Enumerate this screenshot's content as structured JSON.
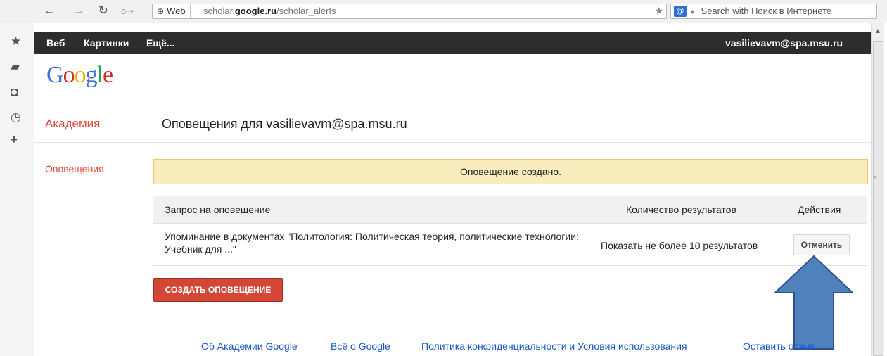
{
  "browser": {
    "back_icon": "arrow-left-icon",
    "forward_icon": "arrow-right-icon",
    "reload_icon": "reload-icon",
    "key_icon": "key-icon",
    "web_label": "Web",
    "url_prefix": "scholar.",
    "url_domain": "google.ru",
    "url_path": "/scholar_alerts",
    "search_placeholder": "Search with Поиск в Интернете"
  },
  "gbar": {
    "items": [
      "Веб",
      "Картинки",
      "Ещё..."
    ],
    "user": "vasilievavm@spa.msu.ru"
  },
  "logo": {
    "parts": [
      "G",
      "o",
      "o",
      "g",
      "l",
      "e"
    ]
  },
  "header": {
    "section": "Академия",
    "title": "Оповещения для vasilievavm@spa.msu.ru"
  },
  "sidebar": {
    "link": "Оповещения"
  },
  "notice": {
    "text": "Оповещение создано."
  },
  "table": {
    "headers": [
      "Запрос на оповещение",
      "Количество результатов",
      "Действия"
    ],
    "rows": [
      {
        "query": "Упоминание в документах \"Политология: Политическая теория, политические технологии: Учебник для ...\"",
        "count": "Показать не более 10 результатов",
        "action": "Отменить"
      }
    ]
  },
  "create_button": "СОЗДАТЬ ОПОВЕЩЕНИЕ",
  "footer": {
    "links": [
      "Об Академии Google",
      "Всё о Google",
      "Политика конфиденциальности и Условия использования",
      "Оставить отзыв"
    ]
  },
  "colors": {
    "accent_red": "#dd4b39",
    "notice_bg": "#f9edbe",
    "link_blue": "#1a57c4",
    "arrow_fill": "#4f81bd"
  }
}
